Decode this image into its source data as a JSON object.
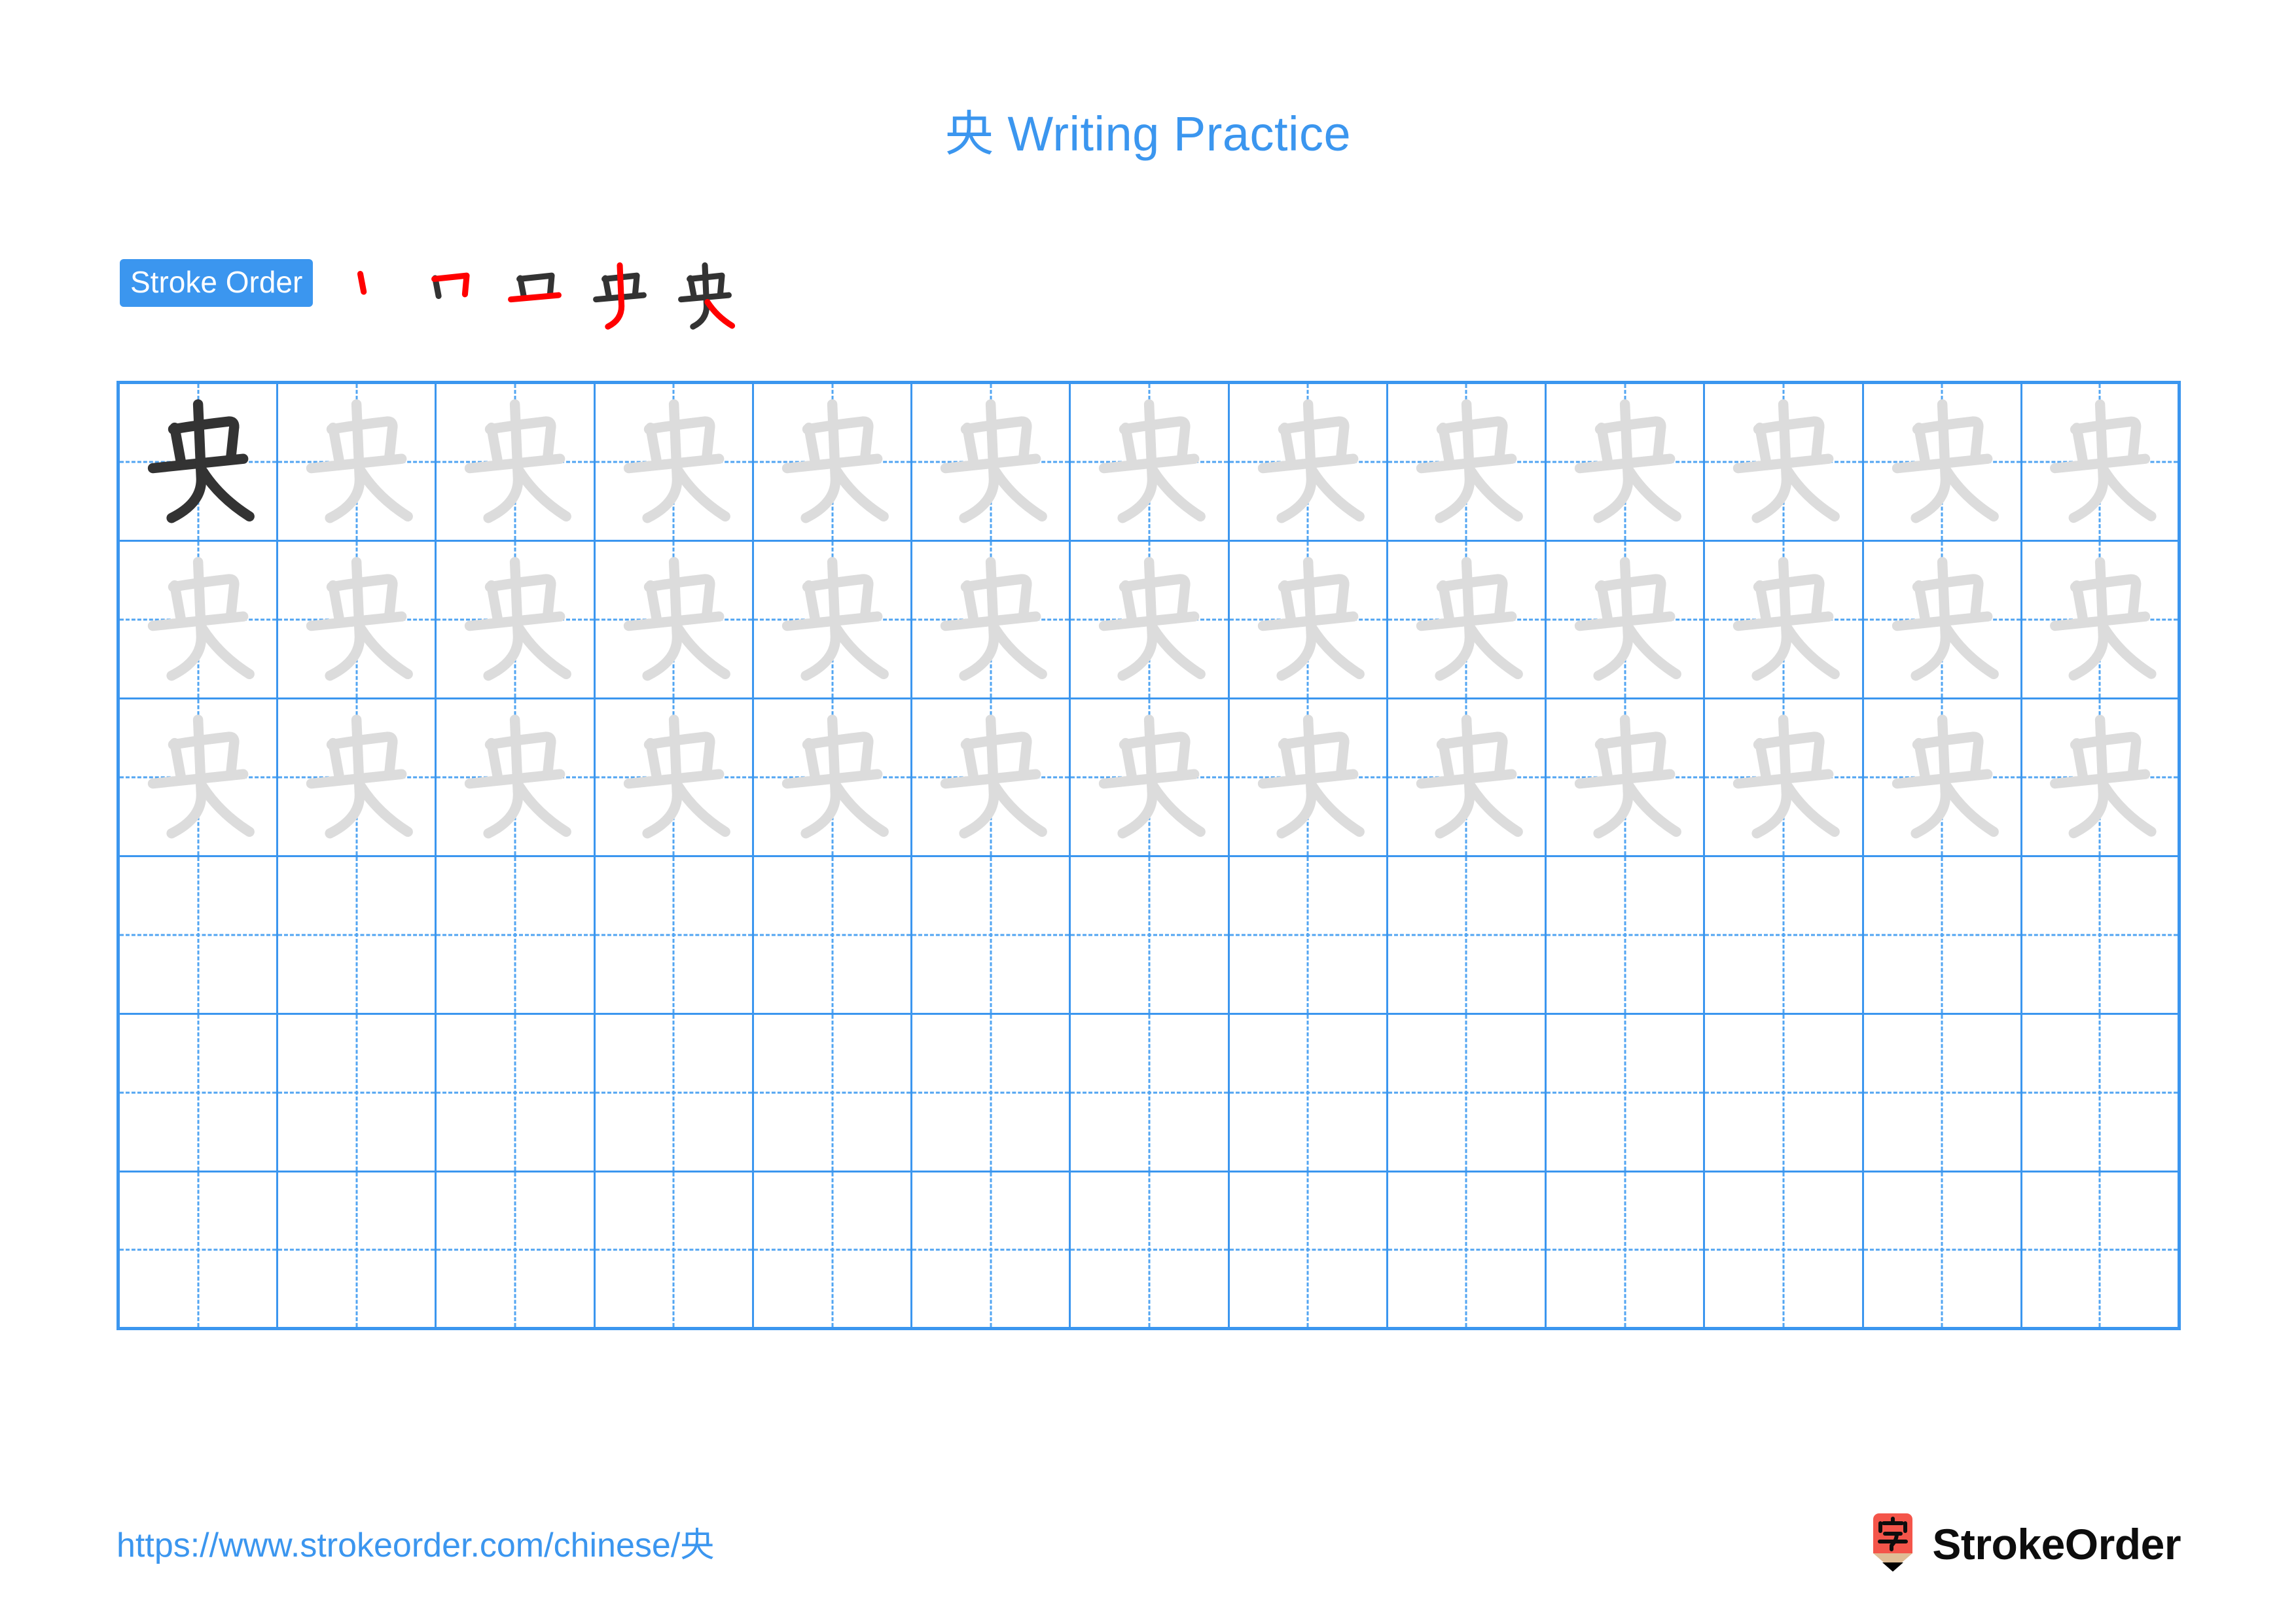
{
  "character": "央",
  "header": {
    "title": "央 Writing Practice",
    "title_color": "#3b96ef"
  },
  "stroke_order": {
    "badge_label": "Stroke Order",
    "badge_bg": "#3b96ef",
    "badge_text_color": "#ffffff",
    "stroke_count": 5,
    "new_stroke_color": "#ff0000",
    "prior_stroke_color": "#333333",
    "stages": [
      {
        "index": 1,
        "strokes_shown": 1,
        "new_stroke": "丿 (short left dot)"
      },
      {
        "index": 2,
        "strokes_shown": 2,
        "new_stroke": "横折 (horizontal turn)"
      },
      {
        "index": 3,
        "strokes_shown": 3,
        "new_stroke": "横 (horizontal)"
      },
      {
        "index": 4,
        "strokes_shown": 4,
        "new_stroke": "竖 (vertical)"
      },
      {
        "index": 5,
        "strokes_shown": 5,
        "new_stroke": "捺 (right falling)"
      }
    ]
  },
  "grid": {
    "columns": 13,
    "rows": 6,
    "line_color": "#3b96ef",
    "guide_color": "#52a5f2",
    "model_char_color": "#333333",
    "trace_char_color": "#dcdcdc",
    "rows_detail": [
      {
        "row": 1,
        "model_cells": 1,
        "trace_cells": 12,
        "blank_cells": 0
      },
      {
        "row": 2,
        "model_cells": 0,
        "trace_cells": 13,
        "blank_cells": 0
      },
      {
        "row": 3,
        "model_cells": 0,
        "trace_cells": 13,
        "blank_cells": 0
      },
      {
        "row": 4,
        "model_cells": 0,
        "trace_cells": 0,
        "blank_cells": 13
      },
      {
        "row": 5,
        "model_cells": 0,
        "trace_cells": 0,
        "blank_cells": 13
      },
      {
        "row": 6,
        "model_cells": 0,
        "trace_cells": 0,
        "blank_cells": 13
      }
    ]
  },
  "footer": {
    "url": "https://www.strokeorder.com/chinese/央",
    "url_color": "#3b96ef",
    "brand_name": "StrokeOrder",
    "logo_char": "字",
    "logo_body_color": "#f4554a",
    "logo_wood_color": "#e0bd95",
    "logo_tip_color": "#000000"
  }
}
